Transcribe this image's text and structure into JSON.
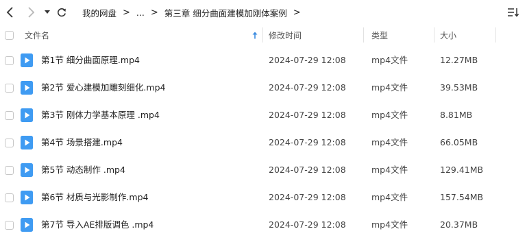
{
  "nav": {
    "breadcrumb": [
      "我的网盘",
      "...",
      "第三章  细分曲面建模加刚体案例"
    ]
  },
  "header": {
    "name": "文件名",
    "modified": "修改时间",
    "type": "类型",
    "size": "大小"
  },
  "files": [
    {
      "name": "第1节 细分曲面原理.mp4",
      "modified": "2024-07-29 12:08",
      "type": "mp4文件",
      "size": "12.27MB"
    },
    {
      "name": "第2节 爱心建模加雕刻细化.mp4",
      "modified": "2024-07-29 12:08",
      "type": "mp4文件",
      "size": "39.53MB"
    },
    {
      "name": "第3节 刚体力学基本原理 .mp4",
      "modified": "2024-07-29 12:08",
      "type": "mp4文件",
      "size": "8.81MB"
    },
    {
      "name": "第4节 场景搭建.mp4",
      "modified": "2024-07-29 12:08",
      "type": "mp4文件",
      "size": "66.05MB"
    },
    {
      "name": "第5节 动态制作  .mp4",
      "modified": "2024-07-29 12:08",
      "type": "mp4文件",
      "size": "129.41MB"
    },
    {
      "name": "第6节 材质与光影制作.mp4",
      "modified": "2024-07-29 12:08",
      "type": "mp4文件",
      "size": "157.54MB"
    },
    {
      "name": "第7节 导入AE排版调色  .mp4",
      "modified": "2024-07-29 12:08",
      "type": "mp4文件",
      "size": "20.37MB"
    }
  ],
  "icons": {
    "back": "chevron-left-icon",
    "forward": "chevron-right-icon",
    "history": "caret-down-icon",
    "refresh": "refresh-icon",
    "sort": "sort-list-icon",
    "sort_arrow": "arrow-up-icon",
    "file": "video-file-icon"
  },
  "colors": {
    "file_icon": "#3f9bf2",
    "sort_arrow": "#3b8be0",
    "divider": "#e2e2e2"
  }
}
